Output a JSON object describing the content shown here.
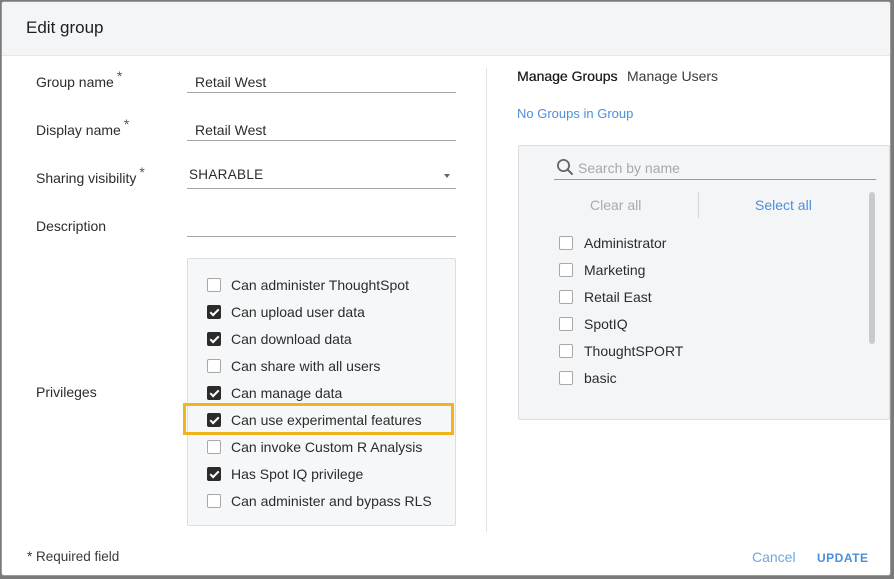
{
  "dialog": {
    "title": "Edit group"
  },
  "form": {
    "group_name": {
      "label": "Group name",
      "value": "Retail West",
      "required_mark": "*"
    },
    "display_name": {
      "label": "Display name",
      "value": "Retail West",
      "required_mark": "*"
    },
    "sharing_visibility": {
      "label": "Sharing visibility",
      "value": "SHARABLE",
      "required_mark": "*"
    },
    "description": {
      "label": "Description",
      "value": ""
    },
    "privileges": {
      "label": "Privileges",
      "items": [
        {
          "label": "Can administer ThoughtSpot",
          "checked": false
        },
        {
          "label": "Can upload user data",
          "checked": true
        },
        {
          "label": "Can download data",
          "checked": true
        },
        {
          "label": "Can share with all users",
          "checked": false
        },
        {
          "label": "Can manage data",
          "checked": true
        },
        {
          "label": "Can use experimental features",
          "checked": true,
          "highlighted": true
        },
        {
          "label": "Can invoke Custom R Analysis",
          "checked": false
        },
        {
          "label": "Has Spot IQ privilege",
          "checked": true
        },
        {
          "label": "Can administer and bypass RLS",
          "checked": false
        }
      ]
    }
  },
  "right_panel": {
    "tabs": [
      {
        "label": "Manage Groups",
        "active": true
      },
      {
        "label": "Manage Users",
        "active": false
      }
    ],
    "status_text": "No Groups in Group",
    "search": {
      "placeholder": "Search by name",
      "value": ""
    },
    "clear_all": "Clear all",
    "select_all": "Select all",
    "groups": [
      {
        "label": "Administrator",
        "checked": false
      },
      {
        "label": "Marketing",
        "checked": false
      },
      {
        "label": "Retail East",
        "checked": false
      },
      {
        "label": "SpotIQ",
        "checked": false
      },
      {
        "label": "ThoughtSPORT",
        "checked": false
      },
      {
        "label": "basic",
        "checked": false
      }
    ]
  },
  "footer": {
    "required_note": "* Required field",
    "cancel_label": "Cancel",
    "update_label": "UPDATE"
  },
  "colors": {
    "accent": "#4a90d9",
    "highlight": "#f1b41c",
    "checkbox_checked": "#2b2b2b"
  }
}
